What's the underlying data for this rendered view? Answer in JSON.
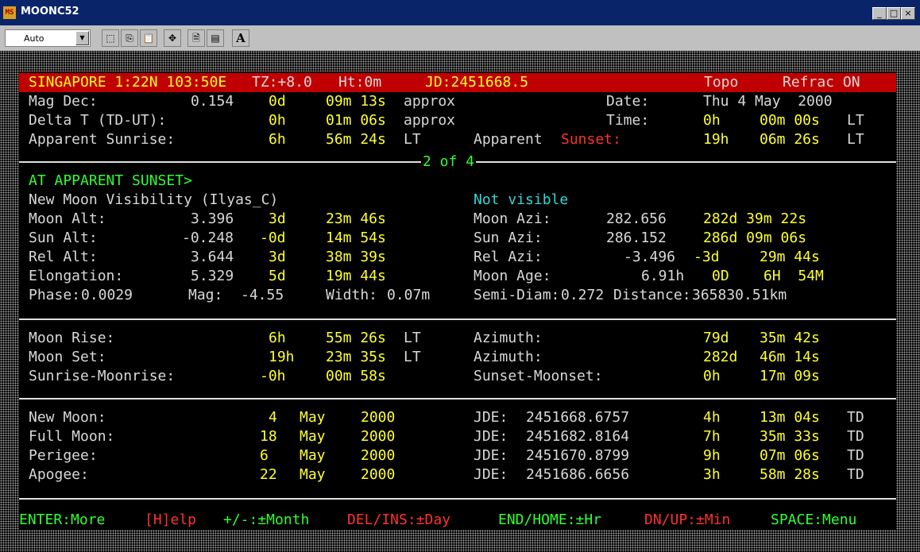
{
  "window": {
    "title": "MOONC52",
    "icon_text": "MS",
    "controls": [
      "_",
      "□",
      "×"
    ]
  },
  "toolbar": {
    "font_select": "Auto",
    "buttons": [
      "select-all-icon",
      "copy-icon",
      "paste-icon",
      "full-screen-icon",
      "properties-icon",
      "background-icon",
      "font-icon"
    ],
    "font_button_label": "A"
  },
  "header": {
    "location": "SINGAPORE 1:22N 103:50E",
    "tz": "TZ:+8.0",
    "ht": "Ht:0m",
    "jd": "JD:2451668.5",
    "mode": "Topo",
    "refrac": "Refrac ON"
  },
  "top": {
    "mag_dec_label": "Mag Dec:",
    "mag_dec_val": "0.154",
    "mag_dec_d": "0d",
    "mag_dec_ms": "09m 13s",
    "mag_dec_note": "approx",
    "date_label": "Date:",
    "date_val": "Thu 4 May  2000",
    "delta_t_label": "Delta T (TD-UT):",
    "delta_t_h": "0h",
    "delta_t_ms": "01m 06s",
    "delta_t_note": "approx",
    "time_label": "Time:",
    "time_h": "0h",
    "time_ms": "00m 00s",
    "time_lt": "LT",
    "sunrise_label": "Apparent Sunrise:",
    "sunrise_h": "6h",
    "sunrise_ms": "56m 24s",
    "sunrise_lt": "LT",
    "sunset_label_a": "Apparent",
    "sunset_label_b": "Sunset:",
    "sunset_h": "19h",
    "sunset_ms": "06m 26s",
    "sunset_lt": "LT"
  },
  "page_indicator": "2 of 4",
  "sunset_section": {
    "heading": "AT APPARENT SUNSET>",
    "visibility_label": "New Moon Visibility (Ilyas_C)",
    "visibility_val": "Not visible",
    "moon_alt_label": "Moon Alt:",
    "moon_alt_val": "3.396",
    "moon_alt_d": "3d",
    "moon_alt_ms": "23m 46s",
    "moon_azi_label": "Moon Azi:",
    "moon_azi_val": "282.656",
    "moon_azi_dms": "282d 39m 22s",
    "sun_alt_label": "Sun Alt:",
    "sun_alt_val": "-0.248",
    "sun_alt_d": "-0d",
    "sun_alt_ms": "14m 54s",
    "sun_azi_label": "Sun Azi:",
    "sun_azi_val": "286.152",
    "sun_azi_dms": "286d 09m 06s",
    "rel_alt_label": "Rel Alt:",
    "rel_alt_val": "3.644",
    "rel_alt_d": "3d",
    "rel_alt_ms": "38m 39s",
    "rel_azi_label": "Rel Azi:",
    "rel_azi_val": "-3.496",
    "rel_azi_d": "-3d",
    "rel_azi_ms": "29m 44s",
    "elong_label": "Elongation:",
    "elong_val": "5.329",
    "elong_d": "5d",
    "elong_ms": "19m 44s",
    "age_label": "Moon Age:",
    "age_val": "6.91h",
    "age_dhm": "0D    6H  54M",
    "phase_label": "Phase:",
    "phase_val": "0.0029",
    "mag_label": "Mag:",
    "mag_val": "-4.55",
    "width_label": "Width:",
    "width_val": "0.07m",
    "semidiam_label": "Semi-Diam:",
    "semidiam_val": "0.272",
    "distance_label": "Distance:",
    "distance_val": "365830.51km"
  },
  "rise_set": [
    {
      "label": "Moon Rise:",
      "h": "6h",
      "ms": "55m 26s",
      "lt": "LT",
      "az_label": "Azimuth:",
      "az_d": "79d",
      "az_ms": "35m 42s"
    },
    {
      "label": "Moon Set:",
      "h": "19h",
      "ms": "23m 35s",
      "lt": "LT",
      "az_label": "Azimuth:",
      "az_d": "282d",
      "az_ms": "46m 14s"
    },
    {
      "label": "Sunrise-Moonrise:",
      "h": "-0h",
      "ms": "00m 58s",
      "lt": "",
      "az_label": "Sunset-Moonset:",
      "az_d": "0h",
      "az_ms": "17m 09s"
    }
  ],
  "phases": [
    {
      "label": "New Moon:",
      "day": "4",
      "month": "May",
      "year": "2000",
      "jde_label": "JDE:",
      "jde": "2451668.6757",
      "h": "4h",
      "ms": "13m 04s",
      "td": "TD"
    },
    {
      "label": "Full Moon:",
      "day": "18",
      "month": "May",
      "year": "2000",
      "jde_label": "JDE:",
      "jde": "2451682.8164",
      "h": "7h",
      "ms": "35m 33s",
      "td": "TD"
    },
    {
      "label": "Perigee:",
      "day": "6",
      "month": "May",
      "year": "2000",
      "jde_label": "JDE:",
      "jde": "2451670.8799",
      "h": "9h",
      "ms": "07m 06s",
      "td": "TD"
    },
    {
      "label": "Apogee:",
      "day": "22",
      "month": "May",
      "year": "2000",
      "jde_label": "JDE:",
      "jde": "2451686.6656",
      "h": "3h",
      "ms": "58m 28s",
      "td": "TD"
    }
  ],
  "footer": [
    {
      "text": "ENTER:More",
      "color": "#30ff30"
    },
    {
      "text": "[H]elp",
      "color": "#ff3030"
    },
    {
      "text": "+/-:±Month",
      "color": "#30ff30"
    },
    {
      "text": "DEL/INS:±Day",
      "color": "#ff3030"
    },
    {
      "text": "END/HOME:±Hr",
      "color": "#30ff30"
    },
    {
      "text": "DN/UP:±Min",
      "color": "#ff3030"
    },
    {
      "text": "SPACE:Menu",
      "color": "#30ff30"
    }
  ]
}
